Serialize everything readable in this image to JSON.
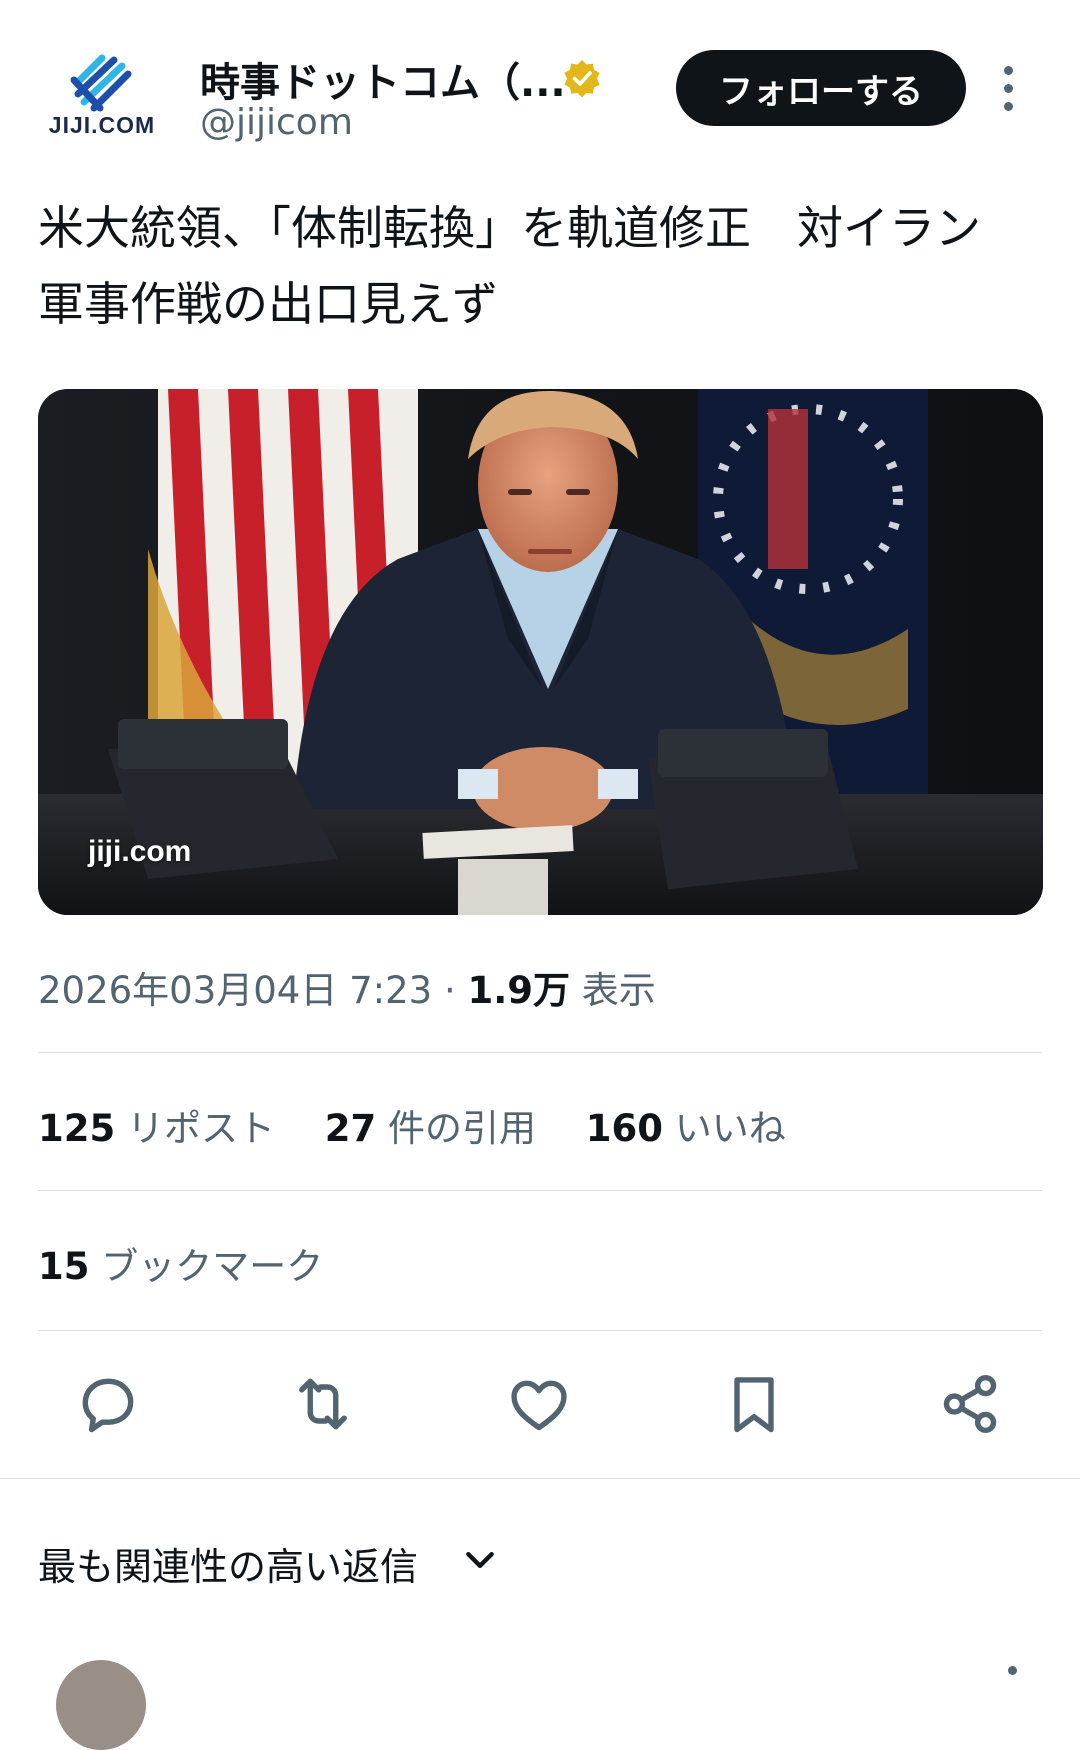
{
  "account": {
    "display_name": "時事ドットコム（...",
    "handle": "@jijicom",
    "logo_text": "JIJI.COM",
    "verified": true
  },
  "header": {
    "follow_label": "フォローする",
    "more_icon": "more-vertical-icon"
  },
  "tweet": {
    "text_line1": "米大統領、「体制転換」を軌道修正　対イラン",
    "text_line2": "軍事作戦の出口見えず",
    "image_watermark": "jiji.com",
    "timestamp": "2026年03月04日 7:23",
    "views_count": "1.9万",
    "views_label": "表示"
  },
  "stats": {
    "reposts_count": "125",
    "reposts_label": "リポスト",
    "quotes_count": "27",
    "quotes_label": "件の引用",
    "likes_count": "160",
    "likes_label": "いいね",
    "bookmarks_count": "15",
    "bookmarks_label": "ブックマーク"
  },
  "actions": [
    "reply-icon",
    "repost-icon",
    "like-icon",
    "bookmark-icon",
    "share-icon"
  ],
  "replies": {
    "sort_label": "最も関連性の高い返信"
  },
  "colors": {
    "text_primary": "#0f1419",
    "text_secondary": "#536471",
    "divider": "#dfe3e6",
    "verified_gold": "#e2b719",
    "follow_button": "#0f1419"
  }
}
